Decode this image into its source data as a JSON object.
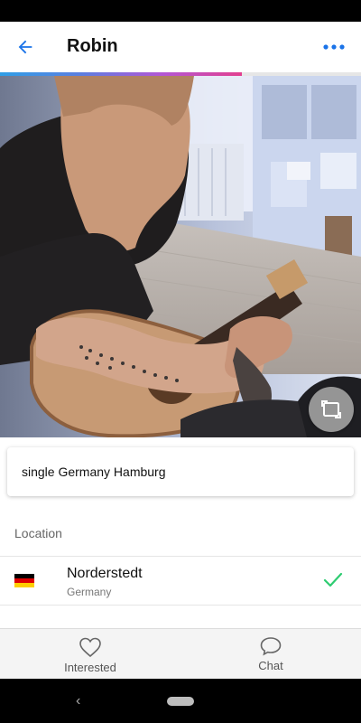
{
  "header": {
    "title": "Robin",
    "back_icon": "arrow-left-icon",
    "menu_icon": "more-horizontal-icon",
    "accent_color": "#1a73e8"
  },
  "profile": {
    "photo_alt": "photo",
    "rotate_icon": "rotate-screen-icon",
    "bio": "single Germany Hamburg"
  },
  "location": {
    "section_label": "Location",
    "city": "Norderstedt",
    "country": "Germany",
    "flag_icon": "germany-flag-icon",
    "check_icon": "check-icon",
    "check_color": "#2ecc71"
  },
  "bottom_nav": {
    "interested_label": "Interested",
    "interested_icon": "heart-outline-icon",
    "chat_label": "Chat",
    "chat_icon": "chat-bubble-icon"
  }
}
